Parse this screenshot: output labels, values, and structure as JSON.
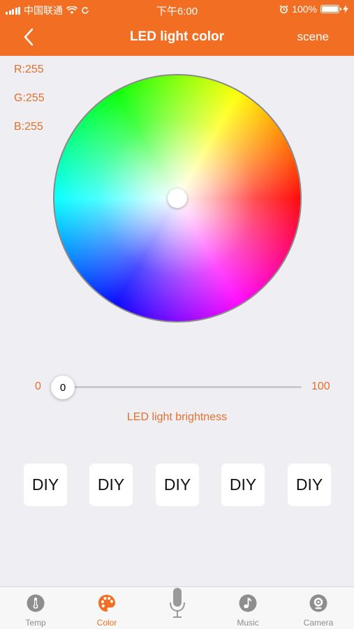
{
  "status_bar": {
    "carrier": "中国联通",
    "time": "下午6:00",
    "battery": "100%"
  },
  "nav": {
    "title": "LED light color",
    "right_label": "scene"
  },
  "rgb": {
    "r": "R:255",
    "g": "G:255",
    "b": "B:255"
  },
  "brightness": {
    "min_label": "0",
    "max_label": "100",
    "value": "0",
    "label": "LED light brightness"
  },
  "diy_buttons": [
    "DIY",
    "DIY",
    "DIY",
    "DIY",
    "DIY"
  ],
  "tabs": [
    {
      "label": "Temp",
      "icon": "thermometer-icon",
      "active": false
    },
    {
      "label": "Color",
      "icon": "palette-icon",
      "active": true
    },
    {
      "label": "",
      "icon": "microphone-icon",
      "active": false
    },
    {
      "label": "Music",
      "icon": "music-note-icon",
      "active": false
    },
    {
      "label": "Camera",
      "icon": "camera-icon",
      "active": false
    }
  ],
  "colors": {
    "accent": "#f26e22",
    "label_orange": "#e0712e",
    "background": "#efeef3"
  }
}
